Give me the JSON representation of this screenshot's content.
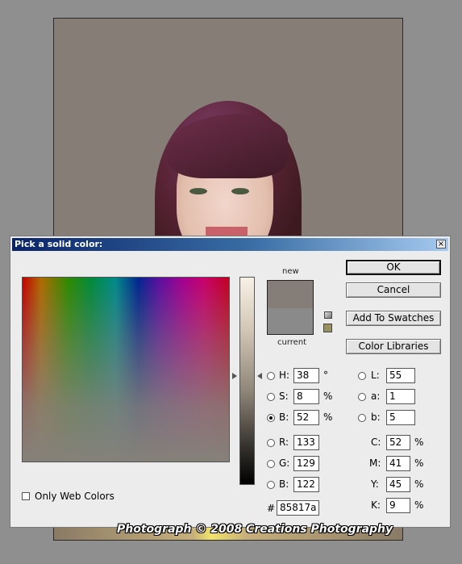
{
  "dialog": {
    "title": "Pick a solid color:",
    "close_glyph": "×"
  },
  "swatch": {
    "new_label": "new",
    "current_label": "current",
    "new_color": "#857d77",
    "current_color": "#8a8a8a"
  },
  "buttons": {
    "ok": "OK",
    "cancel": "Cancel",
    "add_to_swatches": "Add To Swatches",
    "color_libraries": "Color Libraries"
  },
  "hsb": {
    "h": {
      "label": "H:",
      "value": "38",
      "unit": "°",
      "selected": false
    },
    "s": {
      "label": "S:",
      "value": "8",
      "unit": "%",
      "selected": false
    },
    "b": {
      "label": "B:",
      "value": "52",
      "unit": "%",
      "selected": true
    }
  },
  "rgb": {
    "r": {
      "label": "R:",
      "value": "133"
    },
    "g": {
      "label": "G:",
      "value": "129"
    },
    "b": {
      "label": "B:",
      "value": "122"
    }
  },
  "lab": {
    "l": {
      "label": "L:",
      "value": "55"
    },
    "a": {
      "label": "a:",
      "value": "1"
    },
    "b": {
      "label": "b:",
      "value": "5"
    }
  },
  "cmyk": {
    "c": {
      "label": "C:",
      "value": "52",
      "unit": "%"
    },
    "m": {
      "label": "M:",
      "value": "41",
      "unit": "%"
    },
    "y": {
      "label": "Y:",
      "value": "45",
      "unit": "%"
    },
    "k": {
      "label": "K:",
      "value": "9",
      "unit": "%"
    }
  },
  "hex": {
    "label": "#",
    "value": "85817a"
  },
  "web_colors": {
    "label": "Only Web Colors",
    "checked": false
  },
  "watermark": "Photograph © 2008 Creations Photography"
}
